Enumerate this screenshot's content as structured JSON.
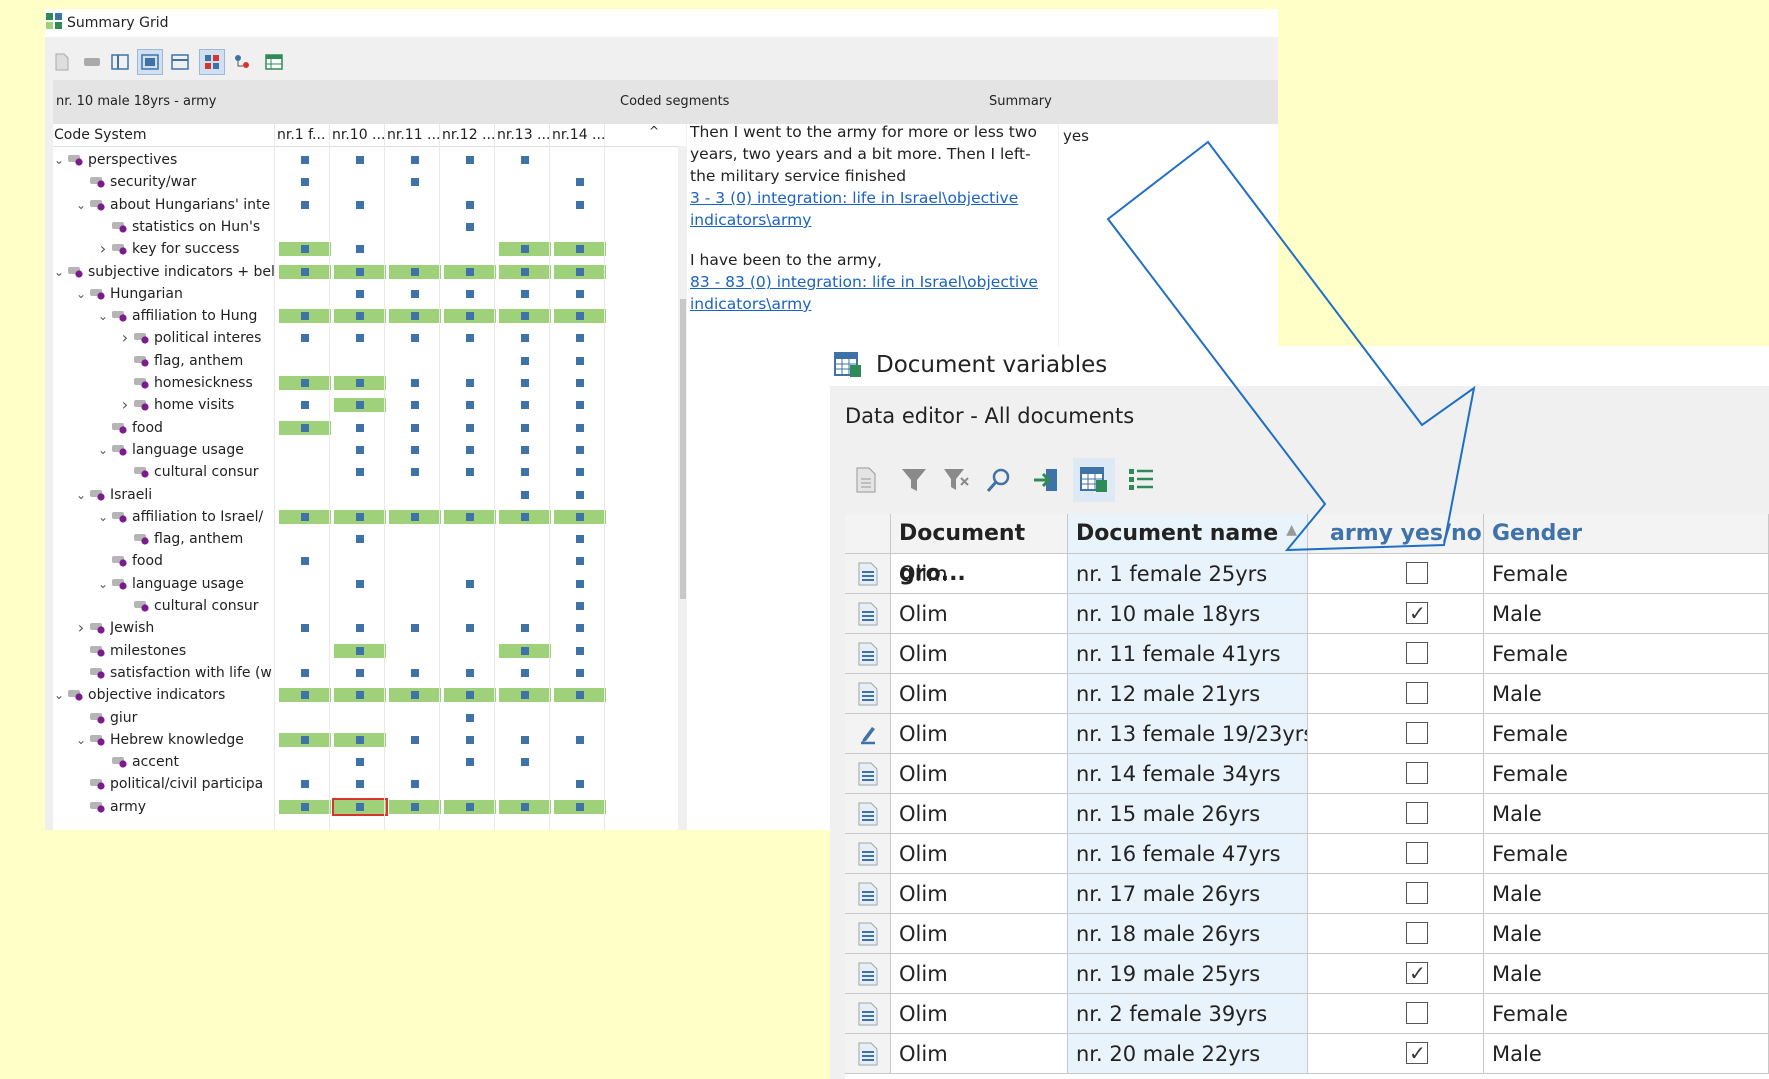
{
  "summary_grid": {
    "title": "Summary Grid",
    "selection_label": "nr. 10 male 18yrs - army",
    "coded_segments_header": "Coded segments",
    "summary_header": "Summary",
    "code_system_header": "Code System",
    "columns": [
      "nr.1 f...",
      "nr.10 ...",
      "nr.11 ...",
      "nr.12 ...",
      "nr.13 ...",
      "nr.14 ..."
    ],
    "rows": [
      {
        "label": "perspectives",
        "depth": 0,
        "toggle": "v",
        "cells": [
          "s",
          "s",
          "s",
          "s",
          "s",
          ""
        ]
      },
      {
        "label": "security/war",
        "depth": 1,
        "toggle": "",
        "cells": [
          "s",
          "",
          "s",
          "",
          "",
          "s"
        ]
      },
      {
        "label": "about Hungarians' inte",
        "depth": 1,
        "toggle": "v",
        "cells": [
          "s",
          "s",
          "",
          "s",
          "",
          "s"
        ]
      },
      {
        "label": "statistics on Hun's",
        "depth": 2,
        "toggle": "",
        "cells": [
          "",
          "",
          "",
          "s",
          "",
          ""
        ]
      },
      {
        "label": "key for success",
        "depth": 2,
        "toggle": ">",
        "cells": [
          "g",
          "s",
          "",
          "",
          "g",
          "g"
        ]
      },
      {
        "label": "subjective indicators + bel",
        "depth": 0,
        "toggle": "v",
        "cells": [
          "g",
          "g",
          "g",
          "g",
          "g",
          "g"
        ]
      },
      {
        "label": "Hungarian",
        "depth": 1,
        "toggle": "v",
        "cells": [
          "",
          "s",
          "s",
          "s",
          "s",
          "s"
        ]
      },
      {
        "label": "affiliation to Hung",
        "depth": 2,
        "toggle": "v",
        "cells": [
          "g",
          "g",
          "g",
          "g",
          "g",
          "g"
        ]
      },
      {
        "label": "political interes",
        "depth": 3,
        "toggle": ">",
        "cells": [
          "s",
          "s",
          "s",
          "s",
          "s",
          "s"
        ]
      },
      {
        "label": "flag, anthem",
        "depth": 3,
        "toggle": "",
        "cells": [
          "",
          "",
          "",
          "",
          "s",
          "s"
        ]
      },
      {
        "label": "homesickness",
        "depth": 3,
        "toggle": "",
        "cells": [
          "g",
          "g",
          "s",
          "s",
          "s",
          "s"
        ]
      },
      {
        "label": "home visits",
        "depth": 3,
        "toggle": ">",
        "cells": [
          "s",
          "g",
          "s",
          "s",
          "s",
          "s"
        ]
      },
      {
        "label": "food",
        "depth": 2,
        "toggle": "",
        "cells": [
          "g",
          "s",
          "s",
          "s",
          "s",
          "s"
        ]
      },
      {
        "label": "language usage",
        "depth": 2,
        "toggle": "v",
        "cells": [
          "",
          "s",
          "s",
          "s",
          "s",
          "s"
        ]
      },
      {
        "label": "cultural consur",
        "depth": 3,
        "toggle": "",
        "cells": [
          "",
          "s",
          "s",
          "s",
          "s",
          "s"
        ]
      },
      {
        "label": "Israeli",
        "depth": 1,
        "toggle": "v",
        "cells": [
          "",
          "",
          "",
          "",
          "s",
          "s"
        ]
      },
      {
        "label": "affiliation to Israel/",
        "depth": 2,
        "toggle": "v",
        "cells": [
          "g",
          "g",
          "g",
          "g",
          "g",
          "g"
        ]
      },
      {
        "label": "flag, anthem",
        "depth": 3,
        "toggle": "",
        "cells": [
          "",
          "s",
          "",
          "",
          "",
          "s"
        ]
      },
      {
        "label": "food",
        "depth": 2,
        "toggle": "",
        "cells": [
          "s",
          "",
          "",
          "",
          "",
          "s"
        ]
      },
      {
        "label": "language usage",
        "depth": 2,
        "toggle": "v",
        "cells": [
          "",
          "s",
          "",
          "s",
          "",
          "s"
        ]
      },
      {
        "label": "cultural consur",
        "depth": 3,
        "toggle": "",
        "cells": [
          "",
          "",
          "",
          "",
          "",
          "s"
        ]
      },
      {
        "label": "Jewish",
        "depth": 1,
        "toggle": ">",
        "cells": [
          "s",
          "s",
          "s",
          "s",
          "s",
          "s"
        ]
      },
      {
        "label": "milestones",
        "depth": 1,
        "toggle": "",
        "cells": [
          "",
          "g",
          "",
          "",
          "g",
          "s"
        ]
      },
      {
        "label": "satisfaction with life (w",
        "depth": 1,
        "toggle": "",
        "cells": [
          "s",
          "s",
          "s",
          "s",
          "s",
          "s"
        ]
      },
      {
        "label": "objective indicators",
        "depth": 0,
        "toggle": "v",
        "cells": [
          "g",
          "g",
          "g",
          "g",
          "g",
          "g"
        ]
      },
      {
        "label": "giur",
        "depth": 1,
        "toggle": "",
        "cells": [
          "",
          "",
          "",
          "s",
          "",
          ""
        ]
      },
      {
        "label": "Hebrew knowledge",
        "depth": 1,
        "toggle": "v",
        "cells": [
          "g",
          "g",
          "s",
          "s",
          "s",
          "s"
        ]
      },
      {
        "label": "accent",
        "depth": 2,
        "toggle": "",
        "cells": [
          "",
          "s",
          "",
          "s",
          "s",
          ""
        ]
      },
      {
        "label": "political/civil participa",
        "depth": 1,
        "toggle": "",
        "cells": [
          "s",
          "s",
          "s",
          "",
          "",
          "s"
        ]
      },
      {
        "label": "army",
        "depth": 1,
        "toggle": "",
        "cells": [
          "g",
          "G",
          "g",
          "g",
          "g",
          "g"
        ]
      }
    ],
    "segments": [
      {
        "text": "Then I went to the army for more or less two years, two years and a bit more. Then I left- the military service finished",
        "link": "3 - 3  (0) integration: life in Israel\\objective indicators\\army"
      },
      {
        "text": "I have been to the army,",
        "link": "83 - 83  (0) integration: life in Israel\\objective indicators\\army"
      }
    ],
    "summary_text": "yes"
  },
  "document_variables": {
    "title": "Document variables",
    "subtitle": "Data editor - All documents",
    "columns": [
      "Document gro...",
      "Document name",
      "army yes/no",
      "Gender"
    ],
    "rows": [
      {
        "group": "Olim",
        "name": "nr. 1 female 25yrs",
        "army": false,
        "gender": "Female",
        "icon": "doc"
      },
      {
        "group": "Olim",
        "name": "nr. 10 male 18yrs",
        "army": true,
        "gender": "Male",
        "icon": "doc"
      },
      {
        "group": "Olim",
        "name": "nr. 11 female 41yrs",
        "army": false,
        "gender": "Female",
        "icon": "doc"
      },
      {
        "group": "Olim",
        "name": "nr. 12 male 21yrs",
        "army": false,
        "gender": "Male",
        "icon": "doc"
      },
      {
        "group": "Olim",
        "name": "nr. 13 female 19/23yrs",
        "army": false,
        "gender": "Female",
        "icon": "edit"
      },
      {
        "group": "Olim",
        "name": "nr. 14 female 34yrs",
        "army": false,
        "gender": "Female",
        "icon": "doc"
      },
      {
        "group": "Olim",
        "name": "nr. 15 male 26yrs",
        "army": false,
        "gender": "Male",
        "icon": "doc"
      },
      {
        "group": "Olim",
        "name": "nr. 16 female 47yrs",
        "army": false,
        "gender": "Female",
        "icon": "doc"
      },
      {
        "group": "Olim",
        "name": "nr. 17 male 26yrs",
        "army": false,
        "gender": "Male",
        "icon": "doc"
      },
      {
        "group": "Olim",
        "name": "nr. 18 male 26yrs",
        "army": false,
        "gender": "Male",
        "icon": "doc"
      },
      {
        "group": "Olim",
        "name": "nr. 19 male 25yrs",
        "army": true,
        "gender": "Male",
        "icon": "doc"
      },
      {
        "group": "Olim",
        "name": "nr. 2 female 39yrs",
        "army": false,
        "gender": "Female",
        "icon": "doc"
      },
      {
        "group": "Olim",
        "name": "nr. 20 male 22yrs",
        "army": true,
        "gender": "Male",
        "icon": "doc"
      }
    ]
  },
  "colors": {
    "background": "#ffffc8",
    "coded_cell": "#9fd07a",
    "marker": "#3f73a8",
    "code_dot": "#7b1b8e",
    "link": "#1a62c4",
    "arrow": "#1f6fc4",
    "selected_cell_border": "#d9342b"
  }
}
